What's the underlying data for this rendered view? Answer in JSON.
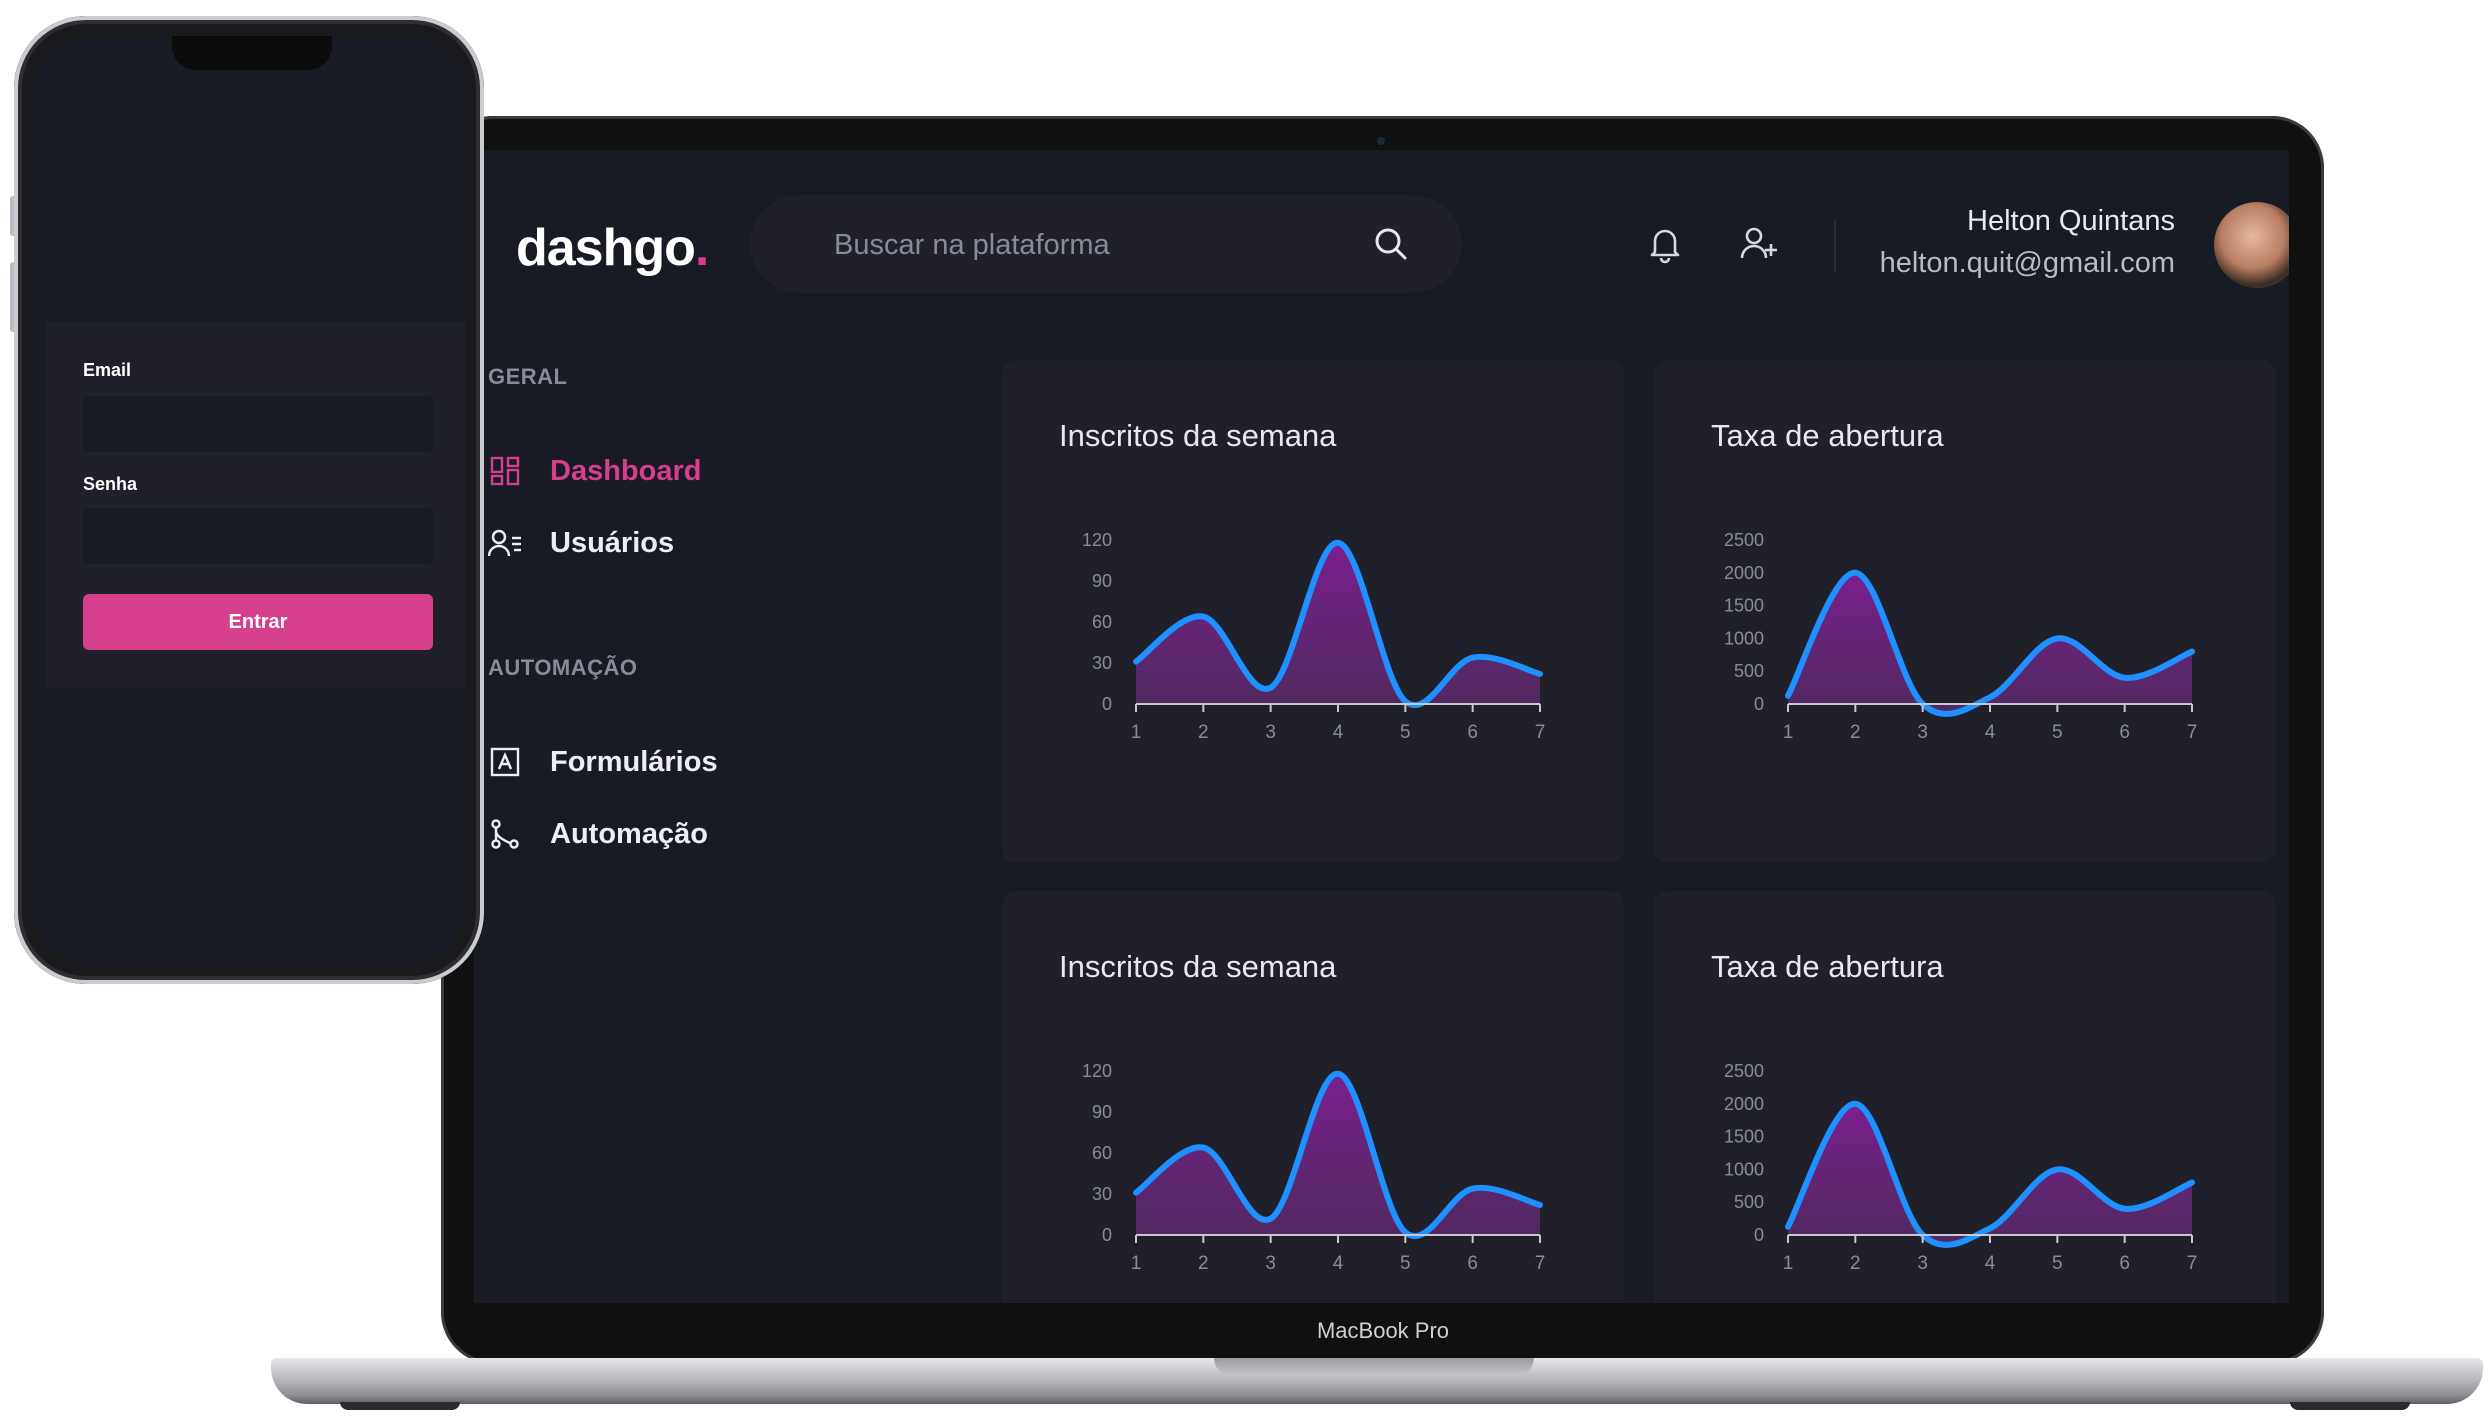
{
  "laptop": {
    "brand": "MacBook Pro"
  },
  "app": {
    "logo_text": "dashgo",
    "logo_dot": ".",
    "search": {
      "placeholder": "Buscar na plataforma"
    },
    "icons": {
      "search": "search-icon",
      "notifications": "bell-icon",
      "add_user": "user-add-icon"
    },
    "user": {
      "name": "Helton Quintans",
      "email": "helton.quit@gmail.com"
    },
    "nav": {
      "sections": [
        {
          "title": "GERAL",
          "items": [
            {
              "label": "Dashboard",
              "icon": "dashboard-icon",
              "active": true
            },
            {
              "label": "Usuários",
              "icon": "users-icon",
              "active": false
            }
          ]
        },
        {
          "title": "AUTOMAÇÃO",
          "items": [
            {
              "label": "Formulários",
              "icon": "form-icon",
              "active": false
            },
            {
              "label": "Automação",
              "icon": "git-branch-icon",
              "active": false
            }
          ]
        }
      ]
    },
    "cards": [
      {
        "title": "Inscritos da semana"
      },
      {
        "title": "Taxa de abertura"
      },
      {
        "title": "Inscritos da semana"
      },
      {
        "title": "Taxa de abertura"
      }
    ],
    "colors": {
      "accent": "#d53f8c",
      "line": "#1e90ff",
      "fill_top": "#7b1f8f",
      "background": "#181b23",
      "card": "#1f2029"
    }
  },
  "chart_data": [
    {
      "type": "area",
      "title": "Inscritos da semana",
      "x": [
        1,
        2,
        3,
        4,
        5,
        6,
        7
      ],
      "y": [
        31,
        64,
        12,
        118,
        2,
        34,
        22
      ],
      "yticks": [
        0,
        30,
        60,
        90,
        120
      ],
      "ylim": [
        0,
        120
      ],
      "grid": false
    },
    {
      "type": "area",
      "title": "Taxa de abertura",
      "x": [
        1,
        2,
        3,
        4,
        5,
        6,
        7
      ],
      "y": [
        126,
        2000,
        0,
        102,
        1000,
        400,
        800
      ],
      "yticks": [
        0,
        500,
        1000,
        1500,
        2000,
        2500
      ],
      "ylim": [
        0,
        2500
      ],
      "grid": false
    },
    {
      "type": "area",
      "title": "Inscritos da semana",
      "x": [
        1,
        2,
        3,
        4,
        5,
        6,
        7
      ],
      "y": [
        31,
        64,
        12,
        118,
        2,
        34,
        22
      ],
      "yticks": [
        0,
        30,
        60,
        90,
        120
      ],
      "ylim": [
        0,
        120
      ],
      "grid": false
    },
    {
      "type": "area",
      "title": "Taxa de abertura",
      "x": [
        1,
        2,
        3,
        4,
        5,
        6,
        7
      ],
      "y": [
        126,
        2000,
        0,
        102,
        1000,
        400,
        800
      ],
      "yticks": [
        0,
        500,
        1000,
        1500,
        2000,
        2500
      ],
      "ylim": [
        0,
        2500
      ],
      "grid": false
    }
  ],
  "phone": {
    "email_label": "Email",
    "email_value": "",
    "password_label": "Senha",
    "password_value": "",
    "submit_label": "Entrar"
  }
}
